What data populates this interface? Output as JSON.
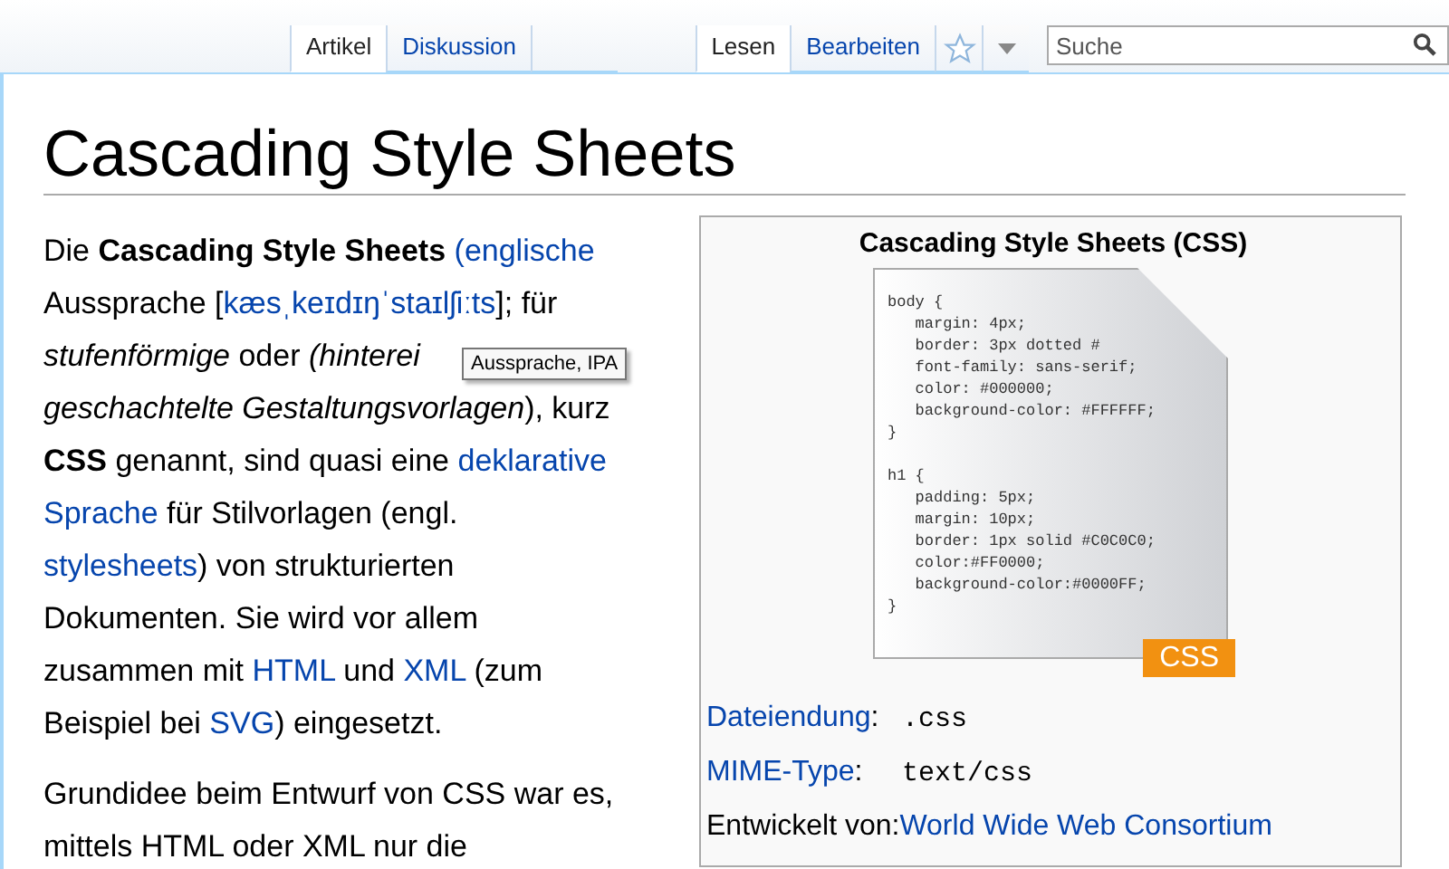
{
  "namespace_tabs": [
    {
      "label": "Artikel",
      "selected": true
    },
    {
      "label": "Diskussion",
      "selected": false
    }
  ],
  "view_tabs": [
    {
      "label": "Lesen",
      "selected": true
    },
    {
      "label": "Bearbeiten",
      "selected": false
    }
  ],
  "search": {
    "placeholder": "Suche"
  },
  "title": "Cascading Style Sheets",
  "paragraphs": [
    {
      "lines": [
        [
          {
            "kind": "text",
            "text": "Die **Cascading Style Sheets** "
          },
          {
            "kind": "link",
            "text": "(englische"
          }
        ],
        [
          {
            "kind": "text",
            "text": "Aussprache ["
          },
          {
            "kind": "link",
            "text": "kæsˌkeɪdɪŋˈstaɪlʃiːts"
          },
          {
            "kind": "text",
            "text": "]; für"
          }
        ],
        [
          {
            "kind": "text",
            "text": "*stufenförmige* oder *(hinterei*"
          }
        ],
        [
          {
            "kind": "text",
            "text": "*geschachtelte Gestaltungsvorlagen*), kurz"
          }
        ],
        [
          {
            "kind": "text",
            "text": "**CSS** genannt, sind quasi eine "
          },
          {
            "kind": "link",
            "text": "deklarative"
          }
        ],
        [
          {
            "kind": "link",
            "text": "Sprache"
          },
          {
            "kind": "text",
            "text": " für Stilvorlagen (engl."
          }
        ],
        [
          {
            "kind": "link",
            "text": "stylesheets"
          },
          {
            "kind": "text",
            "text": ") von strukturierten"
          }
        ],
        [
          {
            "kind": "text",
            "text": "Dokumenten. Sie wird vor allem"
          }
        ],
        [
          {
            "kind": "text",
            "text": "zusammen mit "
          },
          {
            "kind": "link",
            "text": "HTML"
          },
          {
            "kind": "text",
            "text": " und "
          },
          {
            "kind": "link",
            "text": "XML"
          },
          {
            "kind": "text",
            "text": " (zum"
          }
        ],
        [
          {
            "kind": "text",
            "text": "Beispiel bei "
          },
          {
            "kind": "link",
            "text": "SVG"
          },
          {
            "kind": "text",
            "text": ") eingesetzt."
          }
        ]
      ]
    },
    {
      "lines": [
        [
          {
            "kind": "text",
            "text": "Grundidee beim Entwurf von CSS war es,"
          }
        ],
        [
          {
            "kind": "text",
            "text": "mittels HTML oder XML nur die"
          }
        ]
      ]
    }
  ],
  "tooltip": "Aussprache, IPA",
  "infobox": {
    "title": "Cascading Style Sheets (CSS)",
    "code_blocks": [
      [
        "body {",
        "   margin: 4px;",
        "   border: 3px dotted #",
        "   font-family: sans-serif;",
        "   color: #000000;",
        "   background-color: #FFFFFF;",
        "}"
      ],
      [
        "h1 {",
        "   padding: 5px;",
        "   margin: 10px;",
        "   border: 1px solid #C0C0C0;",
        "   color:#FF0000;",
        "   background-color:#0000FF;",
        "}"
      ]
    ],
    "badge": "CSS",
    "rows": [
      {
        "kind": "code",
        "label": "Dateiendung",
        "separator": ":",
        "value": ".css"
      },
      {
        "kind": "code",
        "label": "MIME-Type",
        "separator": ":",
        "value": "text/css"
      },
      {
        "kind": "link",
        "label": "Entwickelt von:",
        "value": "World Wide Web Consortium"
      }
    ]
  }
}
